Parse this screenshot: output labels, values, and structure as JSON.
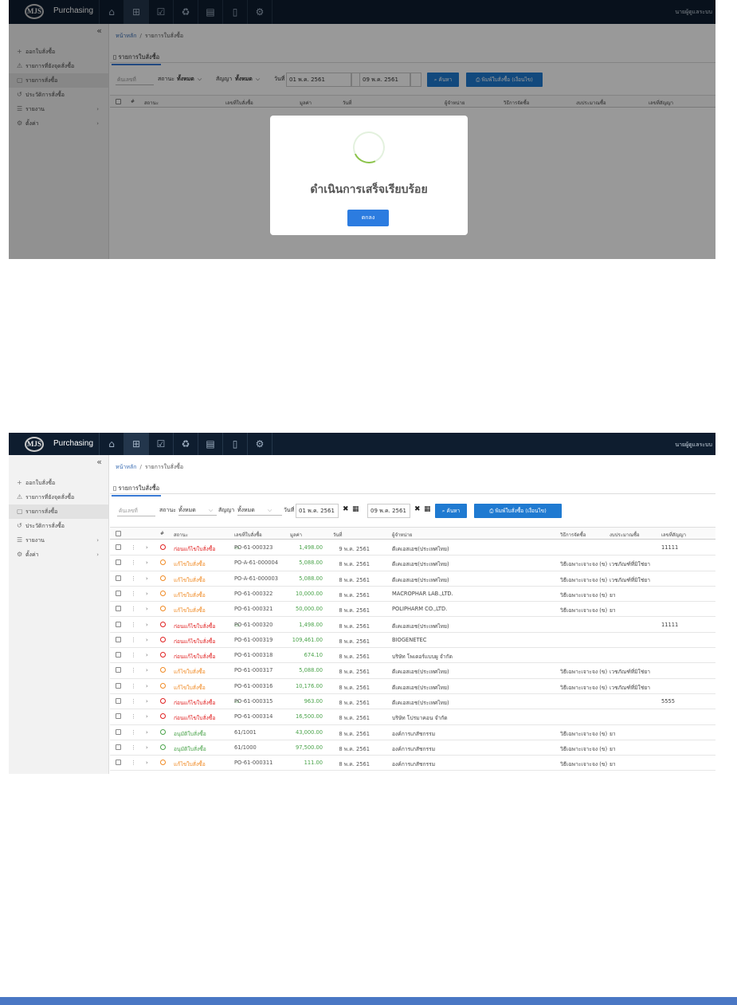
{
  "app": {
    "logo_text": "MJS",
    "title": "Purchasing",
    "user": "นายผู้ดูแลระบบ"
  },
  "nav_icons": [
    "home-icon",
    "cart-icon",
    "checklist-icon",
    "grocery-icon",
    "database-icon",
    "document-icon",
    "settings-icon"
  ],
  "sidebar": {
    "collapse": "«",
    "items": [
      {
        "icon": "+",
        "label": "ออกใบสั่งซื้อ"
      },
      {
        "icon": "⚠",
        "label": "รายการที่ยังจุดสั่งซื้อ"
      },
      {
        "icon": "▢",
        "label": "รายการสั่งซื้อ"
      },
      {
        "icon": "↺",
        "label": "ประวัติการสั่งซื้อ"
      },
      {
        "icon": "☰",
        "label": "รายงาน",
        "chevron": "›"
      },
      {
        "icon": "⚙",
        "label": "ตั้งค่า",
        "chevron": "›"
      }
    ]
  },
  "breadcrumb": {
    "home": "หน้าหลัก",
    "sep": "/",
    "current": "รายการใบสั่งซื้อ"
  },
  "tab": {
    "label": "รายการใบสั่งซื้อ"
  },
  "toolbar": {
    "search_placeholder": "ค้นเลขที่",
    "status_label": "สถานะ",
    "status_value": "ทั้งหมด",
    "contract_label": "สัญญา",
    "contract_value": "ทั้งหมด",
    "date_label": "วันที่",
    "date_from": "01 พ.ค. 2561",
    "date_to": "09 พ.ค. 2561",
    "clear_icon": "✖",
    "calendar_icon": "▦",
    "search_button": "ค้นหา",
    "print_button": "พิมพ์ใบสั่งซื้อ (เงื่อนไข)"
  },
  "table": {
    "headers": {
      "no": "#",
      "status": "สถานะ",
      "po_number": "เลขที่ใบสั่งซื้อ",
      "amount": "มูลค่า",
      "date": "วันที่",
      "vendor": "ผู้จำหน่าย",
      "method": "วิธีการจัดซื้อ",
      "budget": "งบประมาณซื้อ",
      "contract_no": "เลขที่สัญญา"
    },
    "rows": [
      {
        "status": "ก่อนแก้ไขใบสั่งซื้อ",
        "status_color": "#e02020",
        "has_doc": true,
        "po": "PO-61-000323",
        "amount": "1,498.00",
        "date": "9 พ.ค. 2561",
        "vendor": "ดีเคเอสเอช(ประเทศไทย)",
        "method": "",
        "budget": "",
        "contract": "11111"
      },
      {
        "status": "แก้ไขใบสั่งซื้อ",
        "status_color": "#f08a24",
        "has_doc": false,
        "po": "PO-A-61-000004",
        "amount": "5,088.00",
        "date": "8 พ.ค. 2561",
        "vendor": "ดีเคเอสเอช(ประเทศไทย)",
        "method": "วิธีเฉพาะเจาะจง (ข)",
        "budget": "เวชภัณฑ์ที่มิใช่ยา",
        "contract": ""
      },
      {
        "status": "แก้ไขใบสั่งซื้อ",
        "status_color": "#f08a24",
        "has_doc": false,
        "po": "PO-A-61-000003",
        "amount": "5,088.00",
        "date": "8 พ.ค. 2561",
        "vendor": "ดีเคเอสเอช(ประเทศไทย)",
        "method": "วิธีเฉพาะเจาะจง (ข)",
        "budget": "เวชภัณฑ์ที่มิใช่ยา",
        "contract": ""
      },
      {
        "status": "แก้ไขใบสั่งซื้อ",
        "status_color": "#f08a24",
        "has_doc": false,
        "po": "PO-61-000322",
        "amount": "10,000.00",
        "date": "8 พ.ค. 2561",
        "vendor": "MACROPHAR LAB.,LTD.",
        "method": "วิธีเฉพาะเจาะจง (ข)",
        "budget": "ยา",
        "contract": ""
      },
      {
        "status": "แก้ไขใบสั่งซื้อ",
        "status_color": "#f08a24",
        "has_doc": false,
        "po": "PO-61-000321",
        "amount": "50,000.00",
        "date": "8 พ.ค. 2561",
        "vendor": "POLIPHARM CO.,LTD.",
        "method": "วิธีเฉพาะเจาะจง (ข)",
        "budget": "ยา",
        "contract": ""
      },
      {
        "status": "ก่อนแก้ไขใบสั่งซื้อ",
        "status_color": "#e02020",
        "has_doc": true,
        "po": "PO-61-000320",
        "amount": "1,498.00",
        "date": "8 พ.ค. 2561",
        "vendor": "ดีเคเอสเอช(ประเทศไทย)",
        "method": "",
        "budget": "",
        "contract": "11111"
      },
      {
        "status": "ก่อนแก้ไขใบสั่งซื้อ",
        "status_color": "#e02020",
        "has_doc": false,
        "po": "PO-61-000319",
        "amount": "109,461.00",
        "date": "8 พ.ค. 2561",
        "vendor": "BIOGENETEC",
        "method": "",
        "budget": "",
        "contract": ""
      },
      {
        "status": "ก่อนแก้ไขใบสั่งซื้อ",
        "status_color": "#e02020",
        "has_doc": false,
        "po": "PO-61-000318",
        "amount": "674.10",
        "date": "8 พ.ค. 2561",
        "vendor": "บริษัท โพเดอร์แบบผู จำกัด",
        "method": "",
        "budget": "",
        "contract": ""
      },
      {
        "status": "แก้ไขใบสั่งซื้อ",
        "status_color": "#f08a24",
        "has_doc": false,
        "po": "PO-61-000317",
        "amount": "5,088.00",
        "date": "8 พ.ค. 2561",
        "vendor": "ดีเคเอสเอช(ประเทศไทย)",
        "method": "วิธีเฉพาะเจาะจง (ข)",
        "budget": "เวชภัณฑ์ที่มิใช่ยา",
        "contract": ""
      },
      {
        "status": "แก้ไขใบสั่งซื้อ",
        "status_color": "#f08a24",
        "has_doc": false,
        "po": "PO-61-000316",
        "amount": "10,176.00",
        "date": "8 พ.ค. 2561",
        "vendor": "ดีเคเอสเอช(ประเทศไทย)",
        "method": "วิธีเฉพาะเจาะจง (ข)",
        "budget": "เวชภัณฑ์ที่มิใช่ยา",
        "contract": ""
      },
      {
        "status": "ก่อนแก้ไขใบสั่งซื้อ",
        "status_color": "#e02020",
        "has_doc": true,
        "po": "PO-61-000315",
        "amount": "963.00",
        "date": "8 พ.ค. 2561",
        "vendor": "ดีเคเอสเอช(ประเทศไทย)",
        "method": "",
        "budget": "",
        "contract": "5555"
      },
      {
        "status": "ก่อนแก้ไขใบสั่งซื้อ",
        "status_color": "#e02020",
        "has_doc": false,
        "po": "PO-61-000314",
        "amount": "16,500.00",
        "date": "8 พ.ค. 2561",
        "vendor": "บริษัท โปรมาคอน จำกัด",
        "method": "",
        "budget": "",
        "contract": ""
      },
      {
        "status": "อนุมัติใบสั่งซื้อ",
        "status_color": "#4aa34a",
        "has_doc": false,
        "po": "61/1001",
        "amount": "43,000.00",
        "date": "8 พ.ค. 2561",
        "vendor": "องค์การเภสัชกรรม",
        "method": "วิธีเฉพาะเจาะจง (ข)",
        "budget": "ยา",
        "contract": ""
      },
      {
        "status": "อนุมัติใบสั่งซื้อ",
        "status_color": "#4aa34a",
        "has_doc": false,
        "po": "61/1000",
        "amount": "97,500.00",
        "date": "8 พ.ค. 2561",
        "vendor": "องค์การเภสัชกรรม",
        "method": "วิธีเฉพาะเจาะจง (ข)",
        "budget": "ยา",
        "contract": ""
      },
      {
        "status": "แก้ไขใบสั่งซื้อ",
        "status_color": "#f08a24",
        "has_doc": false,
        "po": "PO-61-000311",
        "amount": "111.00",
        "date": "8 พ.ค. 2561",
        "vendor": "องค์การเภสัชกรรม",
        "method": "วิธีเฉพาะเจาะจง (ข)",
        "budget": "ยา",
        "contract": ""
      }
    ]
  },
  "modal": {
    "message": "ดำเนินการเสร็จเรียบร้อย",
    "ok_button": "ตกลง"
  },
  "colors": {
    "topbar": "#0e1d2f",
    "accent": "#1f7ad1",
    "amount": "#4aa34a",
    "footer": "#4a77c4"
  }
}
